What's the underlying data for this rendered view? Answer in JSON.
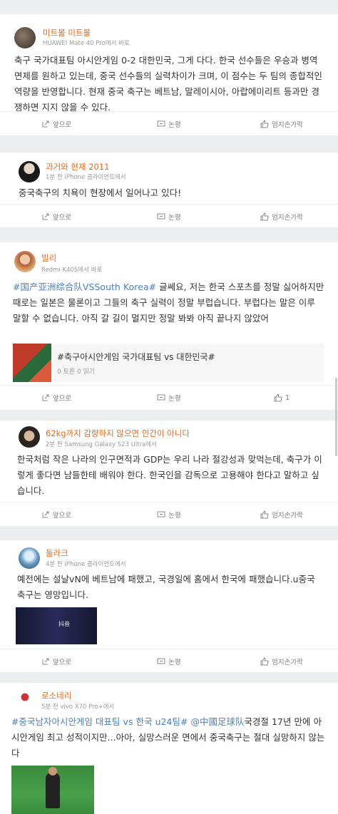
{
  "posts": [
    {
      "username": "미트볼 미트볼",
      "meta": "HUAWEI Mate 40 Pro에서 바로",
      "text": "축구 국가대표팀 아시안게임 0-2 대한민국, 그게 다다. 한국 선수들은 우승과 병역 면제를 원하고 있는데, 중국 선수들의 실력차이가 크며, 이 점수는 두 팀의 종합적인 역량을 반영합니다. 현재 중국 축구는 베트남, 말레이시아, 아랍에미리트 등과만 경쟁하면 지지 않을 수 있다.",
      "actions": {
        "share": "앞으로",
        "comment": "논평",
        "like": "엄지손가락"
      }
    },
    {
      "username": "과거와 현재 2011",
      "meta": "1분 전 iPhone 클라이언트에서",
      "text": "중국축구의 치욕이 현장에서 일어나고 있다!",
      "actions": {
        "share": "앞으로",
        "comment": "논평",
        "like": "엄지손가락"
      }
    },
    {
      "username": "빌리",
      "meta": "Redmi K40S에서 바로",
      "hashtag": "#国产亚洲综合队VSSouth Korea#",
      "text": " 글쎄요, 저는 한국 스포츠를 정말 싫어하지만 때로는 일본은 물론이고 그들의 축구 실력이 정말 부럽습니다. 부럽다는 말은 이루 말할 수 없습니다. 아직 갈 길이 멀지만 정말 봐봐 아직 끝나지 않았어",
      "topic": {
        "title": "#축구아시안게임 국가대표팀 vs 대한민국#",
        "sub": "0 토론 0 읽기"
      },
      "actions": {
        "share": "앞으로",
        "comment": "논평",
        "like": "1"
      }
    },
    {
      "username": "62kg까지 감량하지 않으면 인간이 아니다",
      "meta": "2분 전 Samsung Galaxy S23 Ultra에서",
      "text": "한국처럼 작은 나라의 인구면적과 GDP는 우리 나라 절강성과 맞먹는데, 축구가 이렇게 좋다면 남들한테 배워야 한다. 한국인을 감독으로 고용해야 한다고 말하고 싶습니다.",
      "actions": {
        "share": "앞으로",
        "comment": "논평",
        "like": "엄지손가락"
      }
    },
    {
      "username": "둘라크",
      "meta": "4분 전 iPhone 클라이언트에서",
      "text": "예전에는 설날vN에 베트남에 패했고, 국경일에 홈에서 한국에 패했습니다.u중국 축구는 영망입니다.",
      "media_label": "抖音",
      "actions": {
        "share": "앞으로",
        "comment": "논평",
        "like": "엄지손가락"
      }
    },
    {
      "username": "로소네리",
      "meta": "5분 전 vivo X70 Pro+에서",
      "hashtag": "#중국남자아시안게임 대표팀 vs 한국 u24팀# @中國足球队",
      "text": "국경절 17년 만에 아시안게임 최고 성적이지만...아아, 실망스러운 면에서 중국축구는 절대 실망하지 않는다"
    }
  ],
  "colors": {
    "username": "#e86a18",
    "hashtag": "#4a7fc0",
    "meta": "#9a9a9a",
    "background": "#eceef0"
  }
}
